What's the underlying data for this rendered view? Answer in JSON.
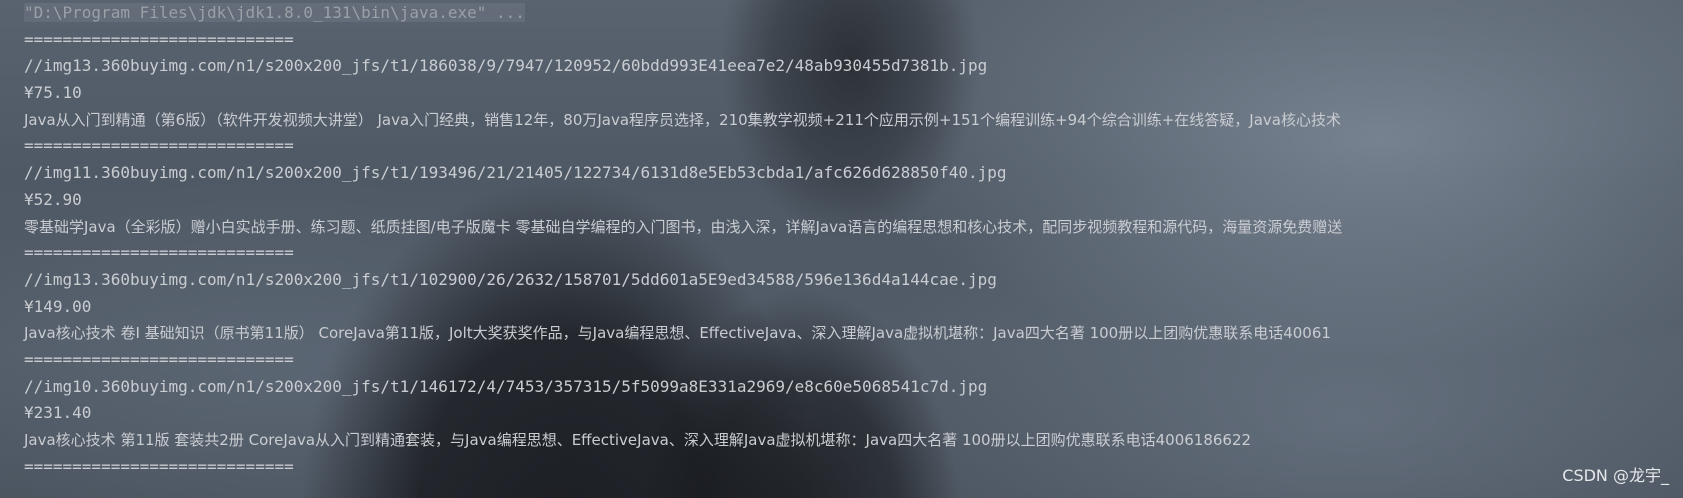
{
  "console": {
    "command": "\"D:\\Program Files\\jdk\\jdk1.8.0_131\\bin\\java.exe\" ...",
    "separator": "============================",
    "records": [
      {
        "image_url": "//img13.360buyimg.com/n1/s200x200_jfs/t1/186038/9/7947/120952/60bdd993E41eea7e2/48ab930455d7381b.jpg",
        "price": "¥75.10",
        "title": "Java从入门到精通（第6版）（软件开发视频大讲堂） Java入门经典，销售12年，80万Java程序员选择，210集教学视频+211个应用示例+151个编程训练+94个综合训练+在线答疑，Java核心技术"
      },
      {
        "image_url": "//img11.360buyimg.com/n1/s200x200_jfs/t1/193496/21/21405/122734/6131d8e5Eb53cbda1/afc626d628850f40.jpg",
        "price": "¥52.90",
        "title": "零基础学Java（全彩版）赠小白实战手册、练习题、纸质挂图/电子版魔卡 零基础自学编程的入门图书，由浅入深，详解Java语言的编程思想和核心技术，配同步视频教程和源代码，海量资源免费赠送"
      },
      {
        "image_url": "//img13.360buyimg.com/n1/s200x200_jfs/t1/102900/26/2632/158701/5dd601a5E9ed34588/596e136d4a144cae.jpg",
        "price": "¥149.00",
        "title": "Java核心技术 卷I 基础知识（原书第11版） CoreJava第11版，Jolt大奖获奖作品，与Java编程思想、EffectiveJava、深入理解Java虚拟机堪称：Java四大名著 100册以上团购优惠联系电话40061"
      },
      {
        "image_url": "//img10.360buyimg.com/n1/s200x200_jfs/t1/146172/4/7453/357315/5f5099a8E331a2969/e8c60e5068541c7d.jpg",
        "price": "¥231.40",
        "title": "Java核心技术 第11版 套装共2册 CoreJava从入门到精通套装，与Java编程思想、EffectiveJava、深入理解Java虚拟机堪称：Java四大名著 100册以上团购优惠联系电话4006186622"
      }
    ],
    "trailing_separator": "============================"
  },
  "watermark": "CSDN @龙宇_"
}
